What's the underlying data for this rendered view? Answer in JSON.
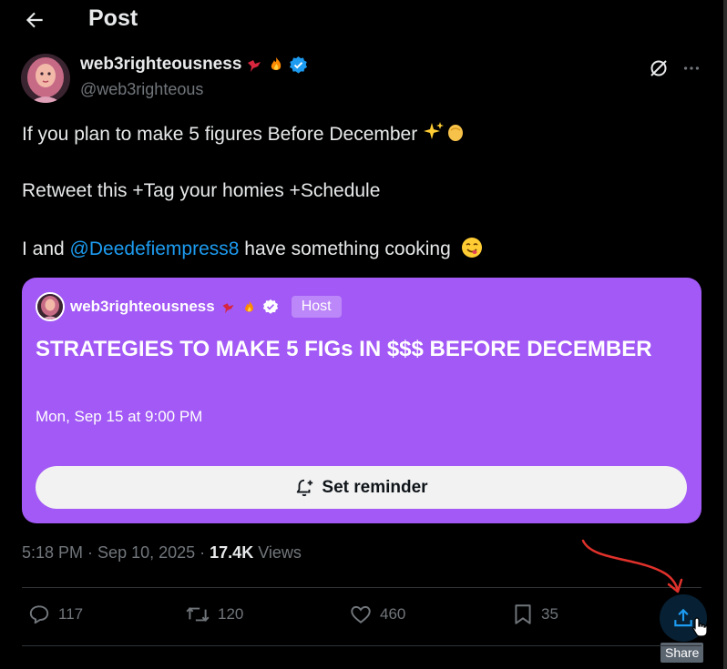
{
  "header": {
    "title": "Post"
  },
  "author": {
    "name": "web3righteousness",
    "handle": "@web3righteous",
    "name_emoji": [
      "bird-icon",
      "fire-icon"
    ],
    "verified": true
  },
  "tweet": {
    "line1": "If you plan to make 5 figures Before December",
    "line2": "Retweet this +Tag your homies +Schedule",
    "line3_prefix": "I and ",
    "mention": "@Deedefiempress8",
    "line3_suffix": " have something cooking "
  },
  "space_card": {
    "host_name": "web3righteousness",
    "host_badge": "Host",
    "title": "STRATEGIES TO MAKE 5 FIGs IN $$$ BEFORE DECEMBER",
    "datetime": "Mon, Sep 15 at 9:00 PM",
    "reminder_label": "Set reminder",
    "background_color": "#a259f5"
  },
  "meta": {
    "time": "5:18 PM",
    "date": "Sep 10, 2025",
    "views_count": "17.4K",
    "views_label": "Views"
  },
  "actions": {
    "replies": "117",
    "reposts": "120",
    "likes": "460",
    "bookmarks": "35",
    "share_tooltip": "Share"
  },
  "colors": {
    "background": "#000000",
    "accent": "#1d9bf0",
    "muted": "#71767b",
    "annotation_arrow": "#e0312b"
  }
}
